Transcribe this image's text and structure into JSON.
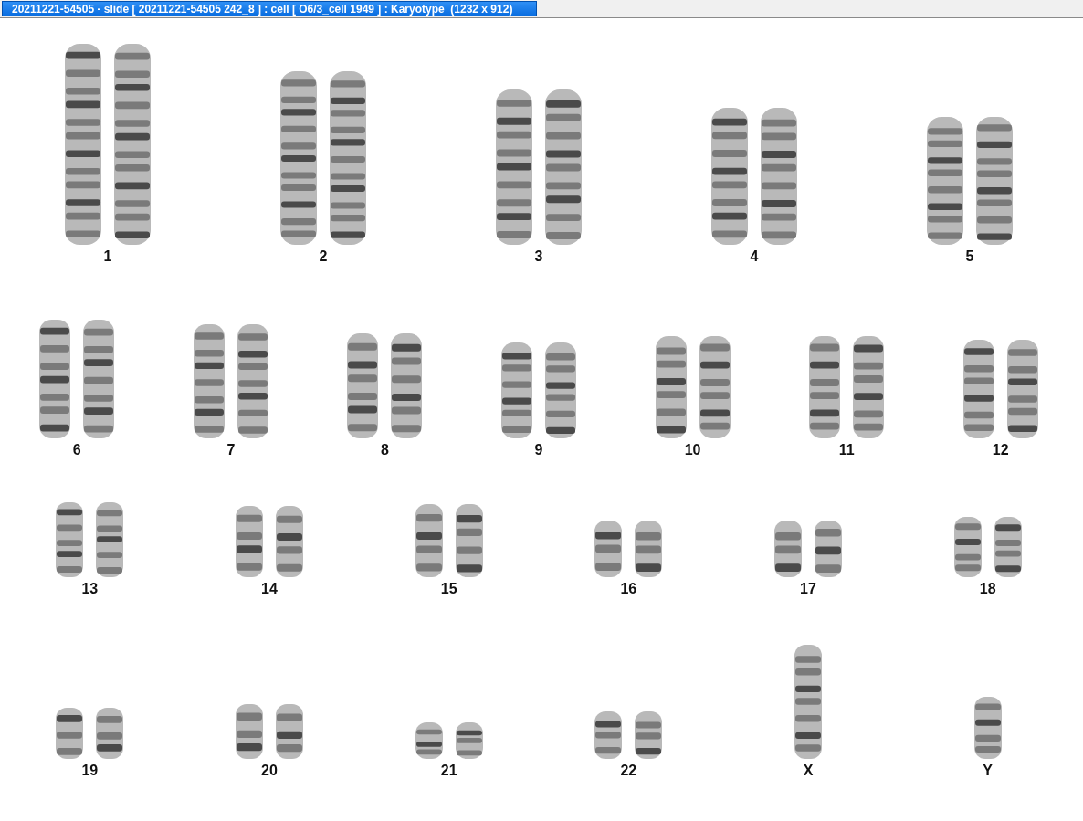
{
  "window": {
    "title": "20211221-54505 - slide [ 20211221-54505 242_8 ] : cell [ O6/3_cell 1949 ] : Karyotype  (1232 x 912)"
  },
  "karyotype": {
    "rows": [
      [
        {
          "label": "1",
          "kind": "pair"
        },
        {
          "label": "2",
          "kind": "pair"
        },
        {
          "label": "3",
          "kind": "pair"
        },
        {
          "label": "4",
          "kind": "pair"
        },
        {
          "label": "5",
          "kind": "pair"
        }
      ],
      [
        {
          "label": "6",
          "kind": "pair"
        },
        {
          "label": "7",
          "kind": "pair"
        },
        {
          "label": "8",
          "kind": "pair"
        },
        {
          "label": "9",
          "kind": "pair"
        },
        {
          "label": "10",
          "kind": "pair"
        },
        {
          "label": "11",
          "kind": "pair"
        },
        {
          "label": "12",
          "kind": "pair"
        }
      ],
      [
        {
          "label": "13",
          "kind": "pair"
        },
        {
          "label": "14",
          "kind": "pair"
        },
        {
          "label": "15",
          "kind": "pair"
        },
        {
          "label": "16",
          "kind": "pair"
        },
        {
          "label": "17",
          "kind": "pair"
        },
        {
          "label": "18",
          "kind": "pair"
        }
      ],
      [
        {
          "label": "19",
          "kind": "pair"
        },
        {
          "label": "20",
          "kind": "pair"
        },
        {
          "label": "21",
          "kind": "pair"
        },
        {
          "label": "22",
          "kind": "pair"
        },
        {
          "label": "X",
          "kind": "single"
        },
        {
          "label": "Y",
          "kind": "single"
        }
      ]
    ]
  }
}
